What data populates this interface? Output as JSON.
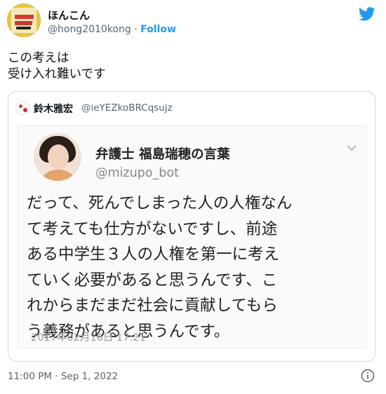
{
  "tweet": {
    "display_name": "ほんこん",
    "handle": "@hong2010kong",
    "separator": "·",
    "follow_label": "Follow",
    "text_lines": [
      "この考えは",
      "受け入れ難いです"
    ],
    "timestamp": "11:00 PM · Sep 1, 2022"
  },
  "quote": {
    "display_name": "鈴木雅宏",
    "handle": "@ieYEZkoBRCqsujz"
  },
  "embedded_screenshot": {
    "name": "弁護士 福島瑞穂の言葉",
    "handle": "@mizupo_bot",
    "body_lines": [
      "だって、死んでしまった人の人権なん",
      "て考えても仕方がないですし、前途",
      "ある中学生３人の人権を第一に考え",
      "ていく必要があると思うんです、こ",
      "れからまだまだ社会に貢献してもら",
      "う義務があると思うんです。"
    ],
    "date": "2017年02月16日 17:21"
  },
  "colors": {
    "accent": "#1d9bf0",
    "text": "#0f1419",
    "secondary": "#536471",
    "border": "#cfd9de"
  },
  "icons": [
    "twitter-bird-icon",
    "chevron-down-icon",
    "info-icon"
  ]
}
